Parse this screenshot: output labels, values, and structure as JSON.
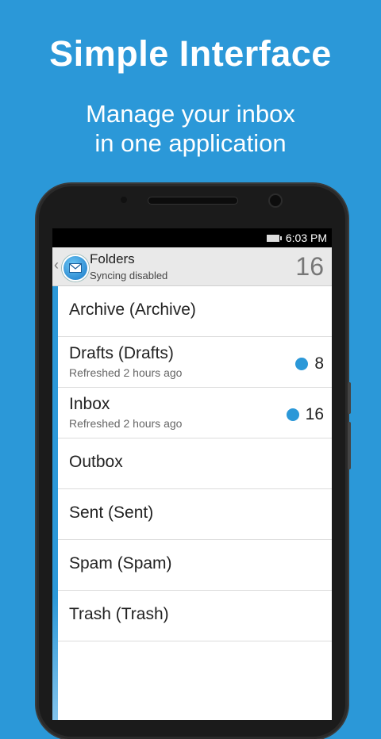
{
  "promo": {
    "title": "Simple Interface",
    "subtitle_line1": "Manage your inbox",
    "subtitle_line2": "in one application"
  },
  "status_bar": {
    "time": "6:03 PM"
  },
  "action_bar": {
    "title": "Folders",
    "subtitle": "Syncing disabled",
    "count": "16",
    "icon": "mail-icon",
    "back": "‹"
  },
  "folders": [
    {
      "name": "Archive (Archive)",
      "meta": "",
      "count": ""
    },
    {
      "name": "Drafts (Drafts)",
      "meta": "Refreshed 2 hours ago",
      "count": "8"
    },
    {
      "name": "Inbox",
      "meta": "Refreshed 2 hours ago",
      "count": "16"
    },
    {
      "name": "Outbox",
      "meta": "",
      "count": ""
    },
    {
      "name": "Sent (Sent)",
      "meta": "",
      "count": ""
    },
    {
      "name": "Spam (Spam)",
      "meta": "",
      "count": ""
    },
    {
      "name": "Trash (Trash)",
      "meta": "",
      "count": ""
    }
  ],
  "colors": {
    "background": "#2b98d8",
    "accent": "#2b98d8"
  }
}
